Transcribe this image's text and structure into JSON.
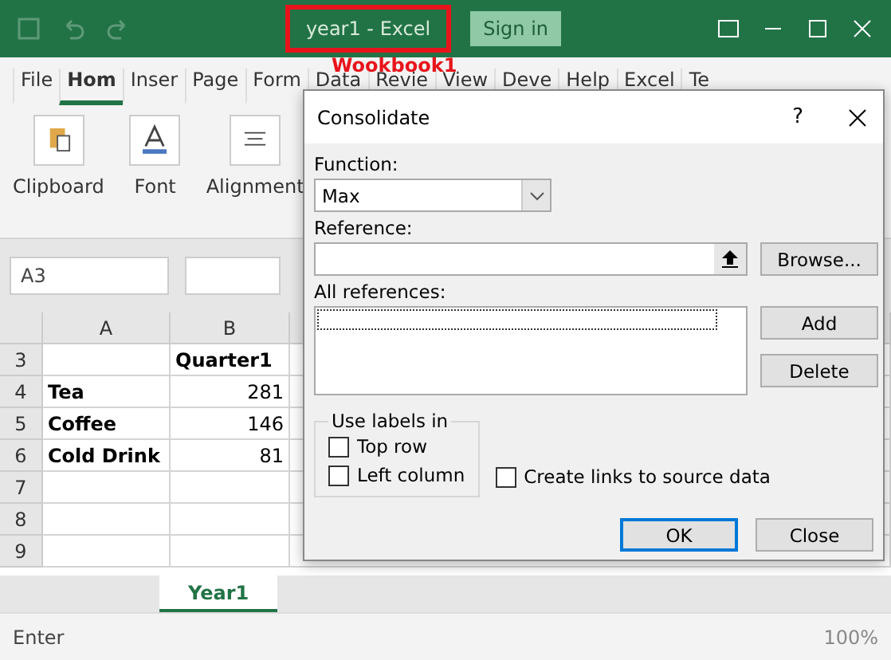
{
  "titlebar": {
    "title": "year1  -  Excel",
    "sign_in": "Sign in",
    "annotation": "Wookbook1"
  },
  "ribbon_tabs": [
    {
      "label": "File",
      "selected": false
    },
    {
      "label": "Hom",
      "selected": true
    },
    {
      "label": "Inser",
      "selected": false
    },
    {
      "label": "Page",
      "selected": false
    },
    {
      "label": "Form",
      "selected": false
    },
    {
      "label": "Data",
      "selected": false
    },
    {
      "label": "Revie",
      "selected": false
    },
    {
      "label": "View",
      "selected": false
    },
    {
      "label": "Deve",
      "selected": false
    },
    {
      "label": "Help",
      "selected": false
    },
    {
      "label": "Excel",
      "selected": false
    },
    {
      "label": "Te",
      "selected": false
    }
  ],
  "ribbon_groups": [
    {
      "label": "Clipboard",
      "kind": "clipboard"
    },
    {
      "label": "Font",
      "kind": "font"
    },
    {
      "label": "Alignment",
      "kind": "alignment"
    }
  ],
  "name_box": "A3",
  "columns": [
    "A",
    "B"
  ],
  "rows": [
    {
      "number": "3",
      "value": "Quarter1"
    },
    {
      "number": "4",
      "label": "Tea",
      "value": "281"
    },
    {
      "number": "5",
      "label": "Coffee",
      "value": "146"
    },
    {
      "number": "6",
      "label": "Cold Drink",
      "value": "81"
    },
    {
      "number": "7"
    },
    {
      "number": "8"
    },
    {
      "number": "9"
    }
  ],
  "sheet_tabs": [
    {
      "label": "Year1",
      "selected": true
    }
  ],
  "status_bar": {
    "mode": "Enter",
    "zoom": "100%"
  },
  "dialog": {
    "title": "Consolidate",
    "help": "?",
    "function_label": "Function:",
    "function_value": "Max",
    "reference_label": "Reference:",
    "browse": "Browse...",
    "all_references_label": "All references:",
    "add": "Add",
    "delete": "Delete",
    "use_labels_title": "Use labels in",
    "label_options": [
      {
        "label": "Top row",
        "checked": false
      },
      {
        "label": "Left column",
        "checked": false
      }
    ],
    "create_links": {
      "label": "Create links to source data",
      "checked": false
    },
    "ok": "OK",
    "close": "Close"
  }
}
